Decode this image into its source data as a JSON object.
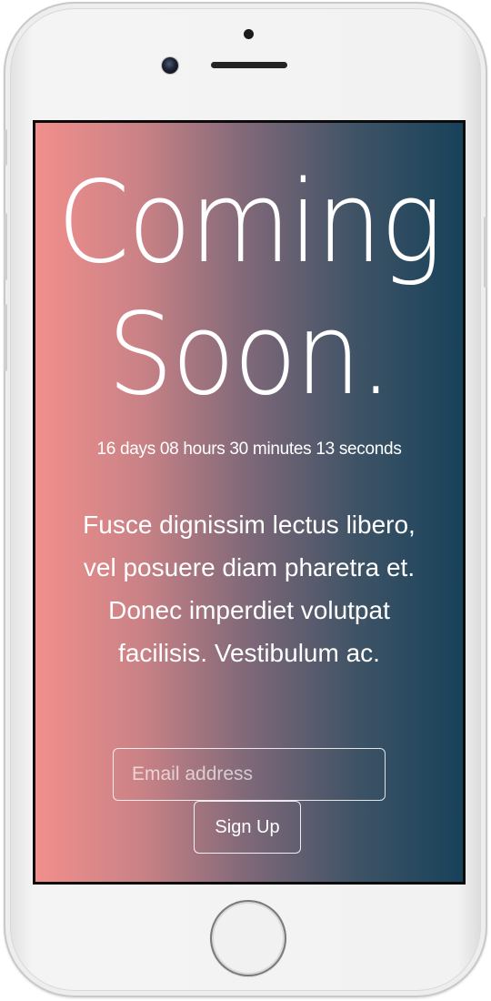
{
  "headline": {
    "line1": "Coming",
    "line2": "Soon."
  },
  "countdown": {
    "text": "16 days 08 hours 30 minutes 13 seconds"
  },
  "description": {
    "text": "Fusce dignissim lectus libero, vel posuere diam pharetra et. Donec imperdiet volutpat facilisis. Vestibulum ac."
  },
  "signup": {
    "email_placeholder": "Email address",
    "email_value": "",
    "button_label": "Sign Up"
  },
  "colors": {
    "gradient_start": "#f28f8c",
    "gradient_end": "#17425a",
    "text": "#ffffff",
    "device_body": "#f2f2f2"
  }
}
